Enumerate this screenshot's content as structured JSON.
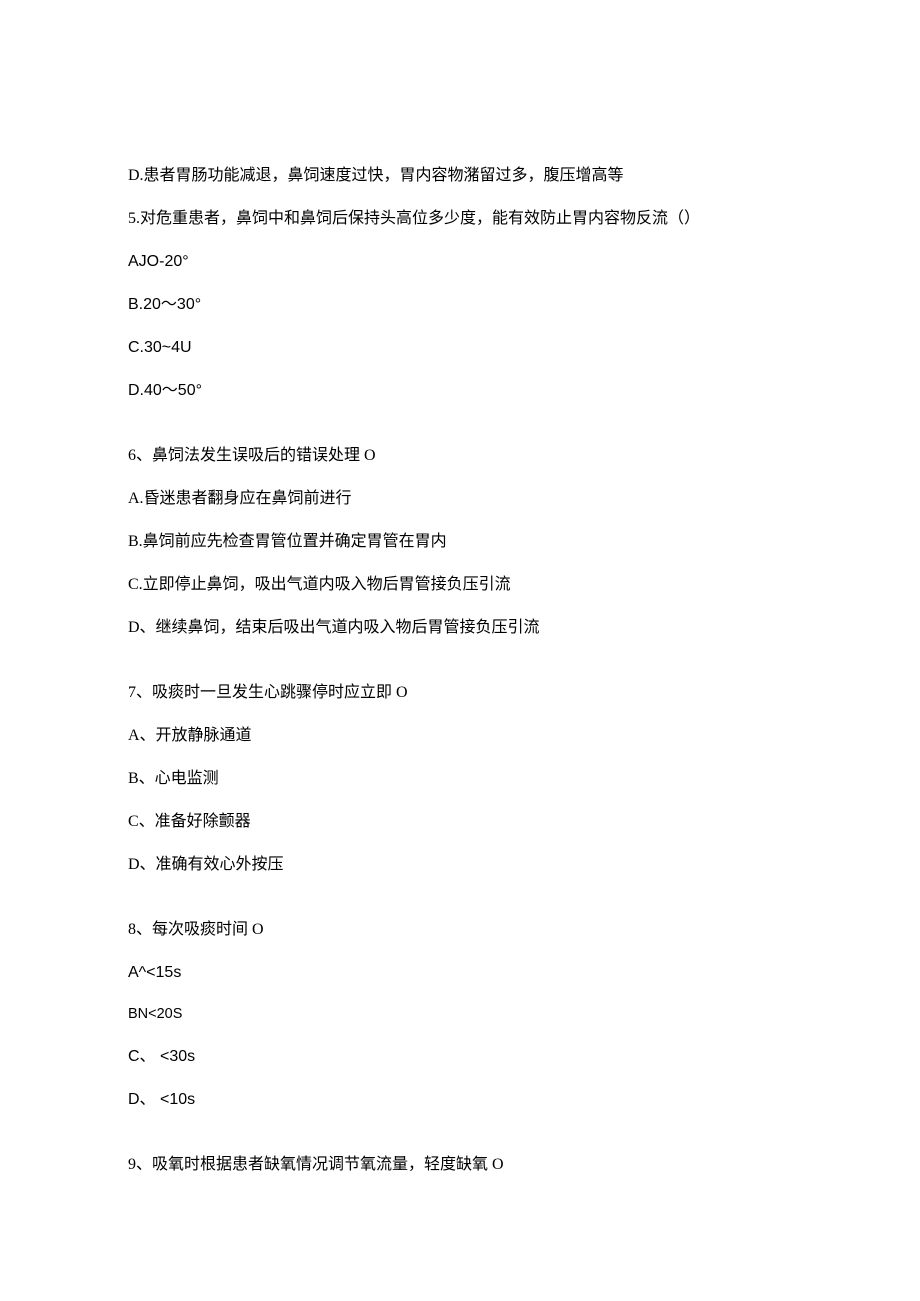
{
  "lines": {
    "q4_optD": "D.患者胃肠功能减退，鼻饲速度过快，胃内容物潴留过多，腹压增高等",
    "q5_stem": "5.对危重患者，鼻饲中和鼻饲后保持头高位多少度，能有效防止胃内容物反流（）",
    "q5_optA": "AJO-20°",
    "q5_optB": "B.20～30°",
    "q5_optC": "C.30~4U",
    "q5_optD": "D.40～50°",
    "q6_stem": "6、鼻饲法发生误吸后的错误处理 O",
    "q6_optA": "A.昏迷患者翻身应在鼻饲前进行",
    "q6_optB": "B.鼻饲前应先检查胃管位置并确定胃管在胃内",
    "q6_optC": "C.立即停止鼻饲，吸出气道内吸入物后胃管接负压引流",
    "q6_optD": "D、继续鼻饲，结束后吸出气道内吸入物后胃管接负压引流",
    "q7_stem": "7、吸痰时一旦发生心跳骤停时应立即 O",
    "q7_optA": "A、开放静脉通道",
    "q7_optB": "B、心电监测",
    "q7_optC": "C、准备好除颤器",
    "q7_optD": "D、准确有效心外按压",
    "q8_stem": "8、每次吸痰时间 O",
    "q8_optA": "A^<15s",
    "q8_optB": "BN<20S",
    "q8_optC": "C、 <30s",
    "q8_optD": "D、 <10s",
    "q9_stem": "9、吸氧时根据患者缺氧情况调节氧流量，轻度缺氧 O"
  }
}
